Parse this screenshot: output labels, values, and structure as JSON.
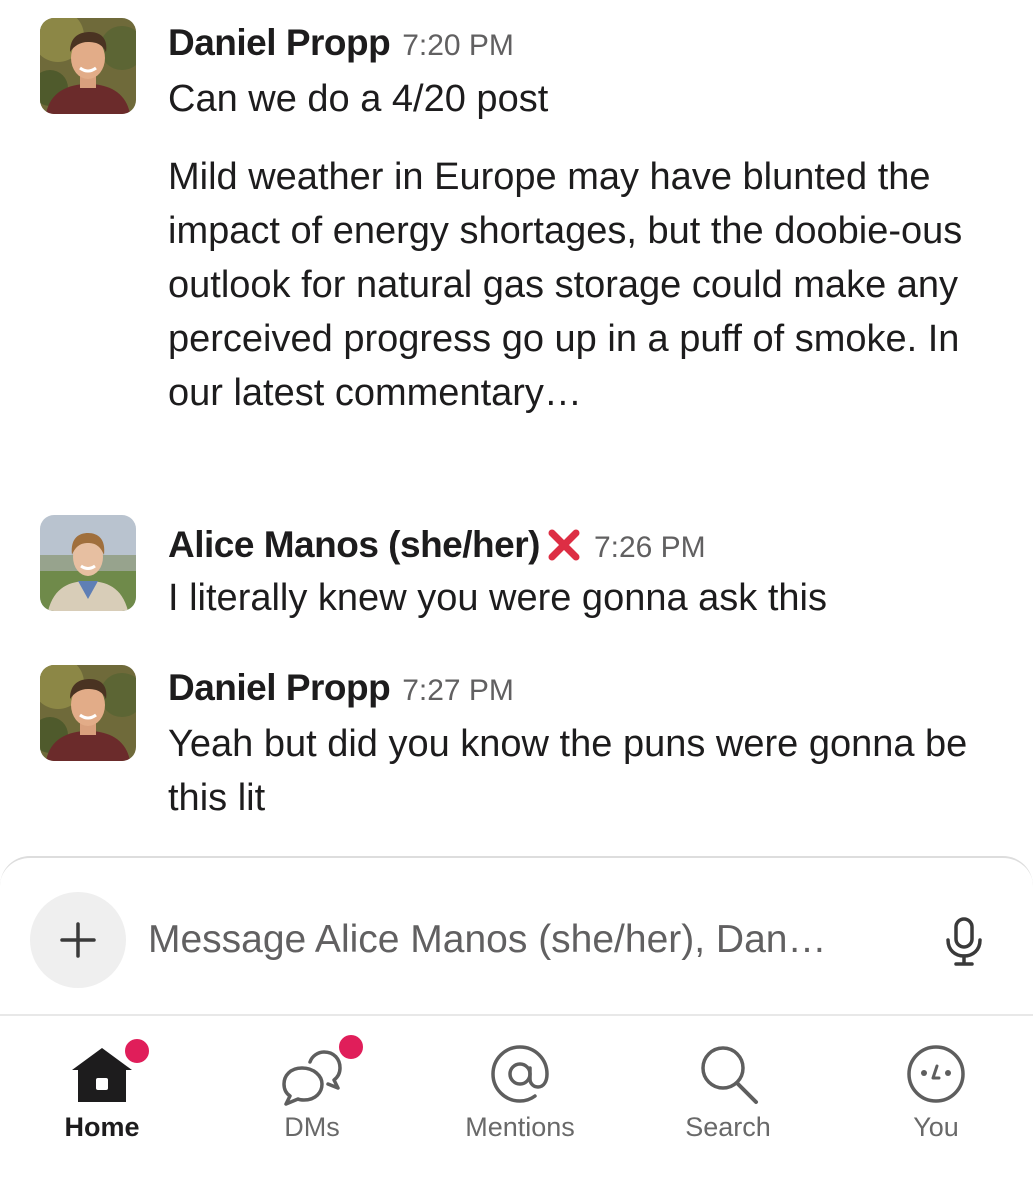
{
  "messages": [
    {
      "sender": "Daniel Propp",
      "time": "7:20 PM",
      "avatar": "daniel-avatar",
      "paragraphs": [
        "Can we do a 4/20 post",
        "Mild weather in Europe may have blunted the impact of energy shortages, but the doobie-ous outlook for natural gas storage could make any perceived progress go up in a puff of smoke. In our latest commentary…"
      ]
    },
    {
      "sender": "Alice Manos (she/her)",
      "status_icon": "red-x-icon",
      "time": "7:26 PM",
      "avatar": "alice-avatar",
      "paragraphs": [
        "I literally knew you were gonna ask this"
      ]
    },
    {
      "sender": "Daniel Propp",
      "time": "7:27 PM",
      "avatar": "daniel-avatar",
      "paragraphs": [
        "Yeah but did you know the puns were gonna be this lit"
      ]
    }
  ],
  "composer": {
    "placeholder": "Message Alice Manos (she/her), Dan…",
    "add_icon": "plus-icon",
    "mic_icon": "microphone-icon"
  },
  "tabs": [
    {
      "label": "Home",
      "icon": "home-icon",
      "active": true,
      "badge": true
    },
    {
      "label": "DMs",
      "icon": "dms-icon",
      "active": false,
      "badge": true
    },
    {
      "label": "Mentions",
      "icon": "mentions-icon",
      "active": false,
      "badge": false
    },
    {
      "label": "Search",
      "icon": "search-icon",
      "active": false,
      "badge": false
    },
    {
      "label": "You",
      "icon": "you-icon",
      "active": false,
      "badge": false
    }
  ],
  "colors": {
    "badge": "#e01e5a",
    "status_x": "#dd2e44",
    "text": "#1d1c1d",
    "muted": "#616061"
  }
}
